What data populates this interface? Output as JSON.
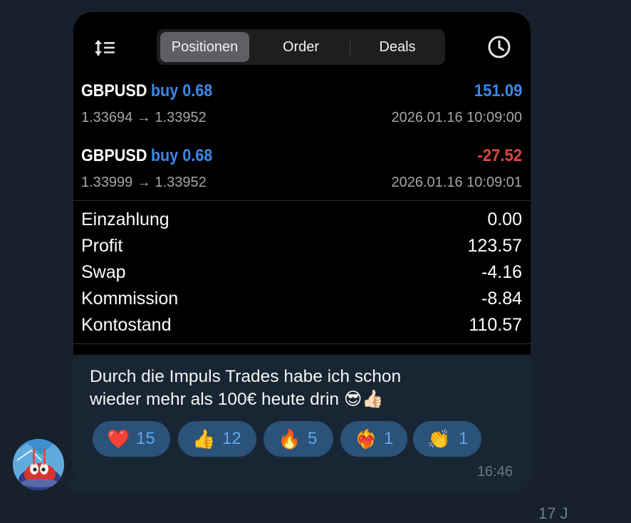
{
  "tabs": [
    {
      "label": "Positionen",
      "active": true
    },
    {
      "label": "Order",
      "active": false
    },
    {
      "label": "Deals",
      "active": false
    }
  ],
  "positions": [
    {
      "symbol": "GBPUSD",
      "side_volume": "buy 0.68",
      "prices": "1.33694 → 1.33952",
      "profit": "151.09",
      "time": "2026.01.16 10:09:00",
      "profit_sign": "positive"
    },
    {
      "symbol": "GBPUSD",
      "side_volume": "buy 0.68",
      "prices": "1.33999 → 1.33952",
      "profit": "-27.52",
      "time": "2026.01.16 10:09:01",
      "profit_sign": "negative"
    }
  ],
  "summary": [
    {
      "label": "Einzahlung",
      "value": "0.00"
    },
    {
      "label": "Profit",
      "value": "123.57"
    },
    {
      "label": "Swap",
      "value": "-4.16"
    },
    {
      "label": "Kommission",
      "value": "-8.84"
    },
    {
      "label": "Kontostand",
      "value": "110.57"
    }
  ],
  "message": {
    "line1": "Durch die Impuls Trades habe ich schon",
    "line2": "wieder mehr als 100€ heute drin",
    "emojis": "😎👍🏻"
  },
  "reactions": [
    {
      "emoji": "❤️",
      "count": "15",
      "icon": "red-heart-icon"
    },
    {
      "emoji": "👍",
      "count": "12",
      "icon": "thumbs-up-icon"
    },
    {
      "emoji": "🔥",
      "count": "5",
      "icon": "fire-icon"
    },
    {
      "emoji": "❤️‍🔥",
      "count": "1",
      "icon": "heart-on-fire-icon"
    },
    {
      "emoji": "👏",
      "count": "1",
      "icon": "clapping-hands-icon"
    }
  ],
  "message_time": "16:46",
  "corner_partial_text": "17 J",
  "colors": {
    "chat_background": "#17212b",
    "bubble": "#182533",
    "reaction_pill": "#2b5278",
    "reaction_count": "#5ea8ed",
    "profit_positive": "#3b88e8",
    "profit_negative": "#e2463f"
  }
}
